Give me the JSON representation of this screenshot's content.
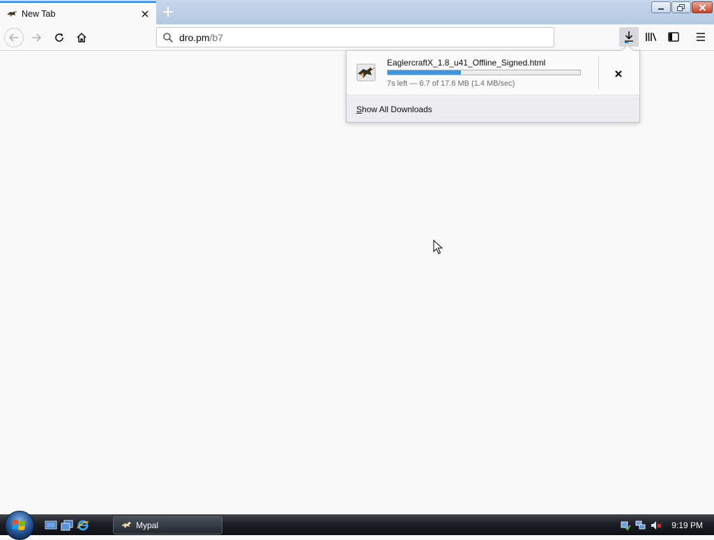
{
  "browser": {
    "tab": {
      "title": "New Tab",
      "favicon": "eagle-favicon-icon",
      "close_icon": "close-icon"
    },
    "new_tab_icon": "plus-icon",
    "window_controls": [
      "minimize-icon",
      "restore-icon",
      "close-icon"
    ],
    "nav": {
      "back_icon": "back-arrow-icon",
      "forward_icon": "forward-arrow-icon",
      "reload_icon": "reload-icon",
      "home_icon": "home-icon"
    },
    "urlbar": {
      "search_icon": "search-icon",
      "host": "dro.pm",
      "path": "/b7"
    },
    "toolbar": {
      "downloads_icon": "download-arrow-icon",
      "library_icon": "library-icon",
      "sidebar_icon": "sidebar-icon",
      "menu_icon": "hamburger-menu-icon"
    }
  },
  "downloads_panel": {
    "item": {
      "filename": "EaglercraftX_1.8_u41_Offline_Signed.html",
      "status": "7s left — 6.7 of 17.6 MB (1.4 MB/sec)",
      "progress_fraction": 0.38,
      "icon": "file-eagle-icon",
      "cancel_icon": "cancel-x-icon"
    },
    "footer": {
      "show_all_accesskey": "S",
      "show_all_rest": "how All Downloads"
    }
  },
  "taskbar": {
    "start_icon": "windows-start-orb-icon",
    "quick_launch": [
      "show-desktop-icon",
      "switch-windows-icon",
      "internet-explorer-icon"
    ],
    "active_task": {
      "label": "Mypal",
      "icon": "eagle-app-icon"
    },
    "tray_icons": [
      "network-check-icon",
      "network-icon",
      "volume-muted-icon"
    ],
    "clock": "9:19 PM"
  },
  "colors": {
    "accent": "#0a84ff",
    "progress": "#3b95e2",
    "page_bg": "#f9f9fa"
  }
}
